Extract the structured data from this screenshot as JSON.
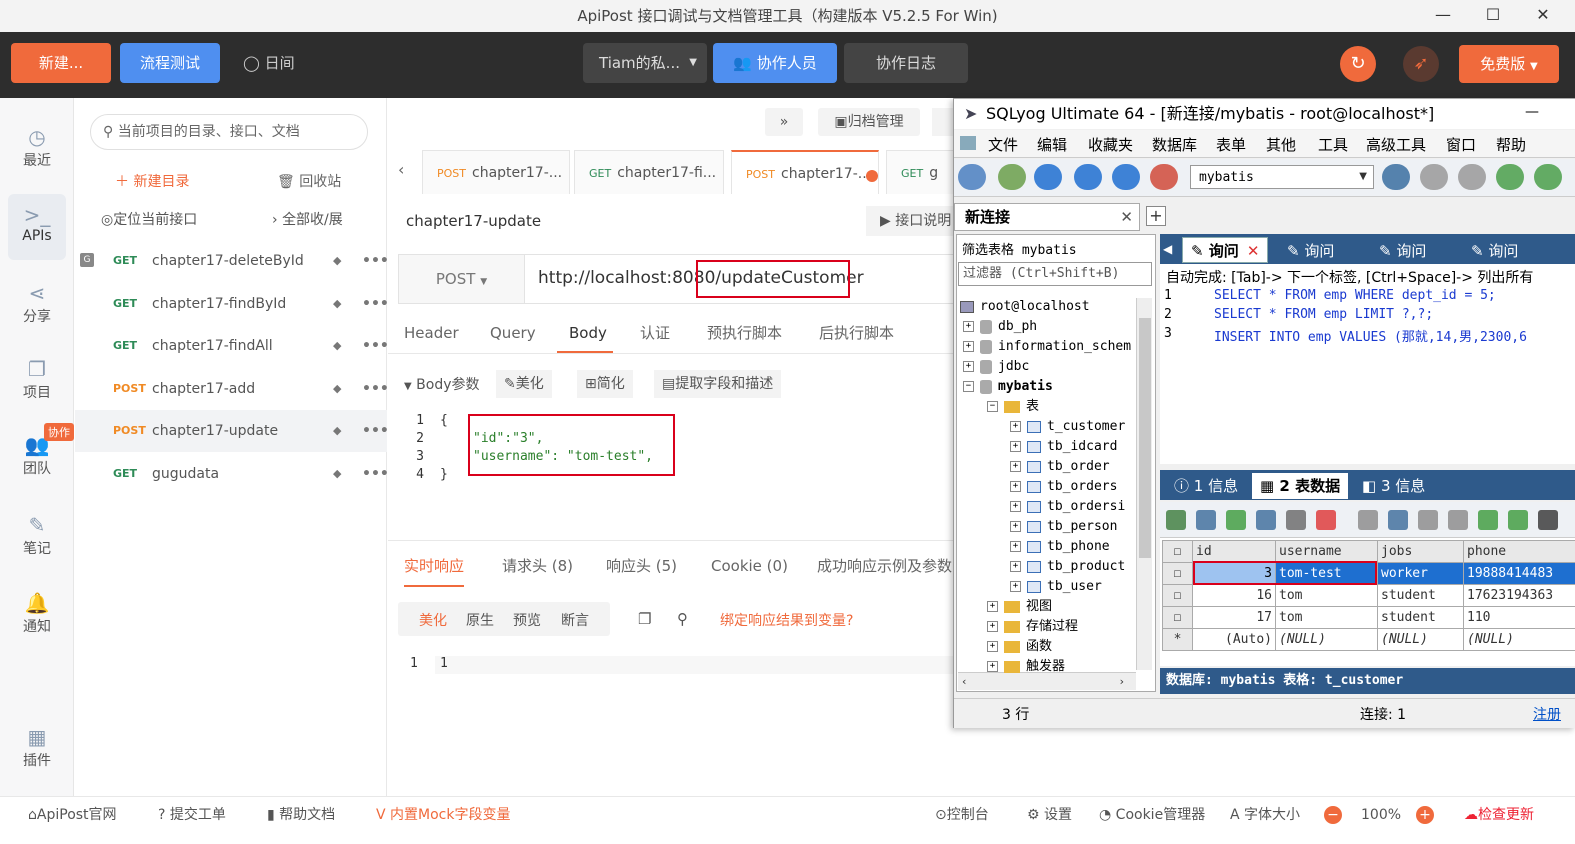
{
  "window": {
    "title": "ApiPost 接口调试与文档管理工具（构建版本 V5.2.5 For Win)"
  },
  "topbar": {
    "new_btn": "新建...",
    "flow_btn": "流程测试",
    "journal": "日间",
    "team_select": "Tiam的私...",
    "members_btn": "协作人员",
    "log_btn": "协作日志",
    "plan_btn": "免费版"
  },
  "nav": {
    "recent": "最近",
    "apis": "APIs",
    "share": "分享",
    "project": "项目",
    "team": "团队",
    "team_badge": "协作",
    "notes": "笔记",
    "notify": "通知",
    "plugins": "插件"
  },
  "sidebar": {
    "search_placeholder": "当前项目的目录、接口、文档",
    "new_dir": "新建目录",
    "trash": "回收站",
    "locate": "定位当前接口",
    "expand": "全部收/展",
    "items": [
      {
        "method": "GET",
        "name": "chapter17-deleteById"
      },
      {
        "method": "GET",
        "name": "chapter17-findById"
      },
      {
        "method": "GET",
        "name": "chapter17-findAll"
      },
      {
        "method": "POST",
        "name": "chapter17-add"
      },
      {
        "method": "POST",
        "name": "chapter17-update"
      },
      {
        "method": "GET",
        "name": "gugudata"
      }
    ]
  },
  "main": {
    "archive": "归档管理",
    "more": "»",
    "tabs": [
      {
        "method": "POST",
        "label": "chapter17-..."
      },
      {
        "method": "GET",
        "label": "chapter17-fi..."
      },
      {
        "method": "POST",
        "label": "chapter17-..."
      },
      {
        "method": "GET",
        "label": "g"
      }
    ],
    "api_name": "chapter17-update",
    "doc_btn": "接口说明",
    "method": "POST",
    "url_base": "http://localhost:8080/",
    "url_path": "updateCustomer",
    "subtabs": [
      "Header",
      "Query",
      "Body",
      "认证",
      "预执行脚本",
      "后执行脚本"
    ],
    "body_label": "Body参数",
    "beautify": "美化",
    "simplify": "简化",
    "extract": "提取字段和描述",
    "code_lines": [
      "{",
      "\"id\":\"3\",",
      "\"username\": \"tom-test\",",
      "}"
    ],
    "line_nums": [
      "1",
      "2",
      "3",
      "4"
    ],
    "resp_tabs": [
      "实时响应",
      "请求头 (8)",
      "响应头 (5)",
      "Cookie (0)",
      "成功响应示例及参数"
    ],
    "resp_opts": [
      "美化",
      "原生",
      "预览",
      "断言"
    ],
    "bind_var": "绑定响应结果到变量?",
    "resp_line": "1",
    "resp_val": "1"
  },
  "statusbar": {
    "site": "ApiPost官网",
    "ticket": "提交工单",
    "help": "帮助文档",
    "mock": "内置Mock字段变量",
    "console": "控制台",
    "settings": "设置",
    "cookie": "Cookie管理器",
    "font": "字体大小",
    "zoom": "100%",
    "update": "检查更新"
  },
  "sqlyog": {
    "title": "SQLyog Ultimate 64 - [新连接/mybatis - root@localhost*]",
    "menus": [
      "文件",
      "编辑",
      "收藏夹",
      "数据库",
      "表单",
      "其他",
      "工具",
      "高级工具",
      "窗口",
      "帮助"
    ],
    "db_select": "mybatis",
    "conn_tab": "新连接",
    "filter_label": "筛选表格 mybatis",
    "filter_placeholder": "过滤器 (Ctrl+Shift+B)",
    "tree": {
      "root": "root@localhost",
      "dbs": [
        "db_ph",
        "information_schem",
        "jdbc",
        "mybatis"
      ],
      "tables_folder": "表",
      "tables": [
        "t_customer",
        "tb_idcard",
        "tb_order",
        "tb_orders",
        "tb_ordersi",
        "tb_person",
        "tb_phone",
        "tb_product",
        "tb_user"
      ],
      "folders": [
        "视图",
        "存储过程",
        "函数",
        "触发器"
      ]
    },
    "query_tabs": [
      "询问",
      "询问",
      "询问",
      "询问"
    ],
    "autocomplete": "自动完成: [Tab]-> 下一个标签, [Ctrl+Space]-> 列出所有",
    "sql": [
      {
        "n": "1",
        "t": "SELECT * FROM emp WHERE dept_id = 5;"
      },
      {
        "n": "2",
        "t": "SELECT * FROM emp LIMIT ?,?;"
      },
      {
        "n": "3",
        "t": "INSERT INTO emp VALUES (那就,14,男,2300,6"
      }
    ],
    "result_tabs": [
      "1 信息",
      "2 表数据",
      "3 信息"
    ],
    "columns": [
      "id",
      "username",
      "jobs",
      "phone"
    ],
    "rows": [
      [
        "3",
        "tom-test",
        "worker",
        "19888414483"
      ],
      [
        "16",
        "tom",
        "student",
        "17623194363"
      ],
      [
        "17",
        "tom",
        "student",
        "110"
      ],
      [
        "(Auto)",
        "(NULL)",
        "(NULL)",
        "(NULL)"
      ]
    ],
    "db_info": "数据库: mybatis  表格: t_customer",
    "row_count": "3 行",
    "conn_count": "连接: 1",
    "register": "注册"
  }
}
